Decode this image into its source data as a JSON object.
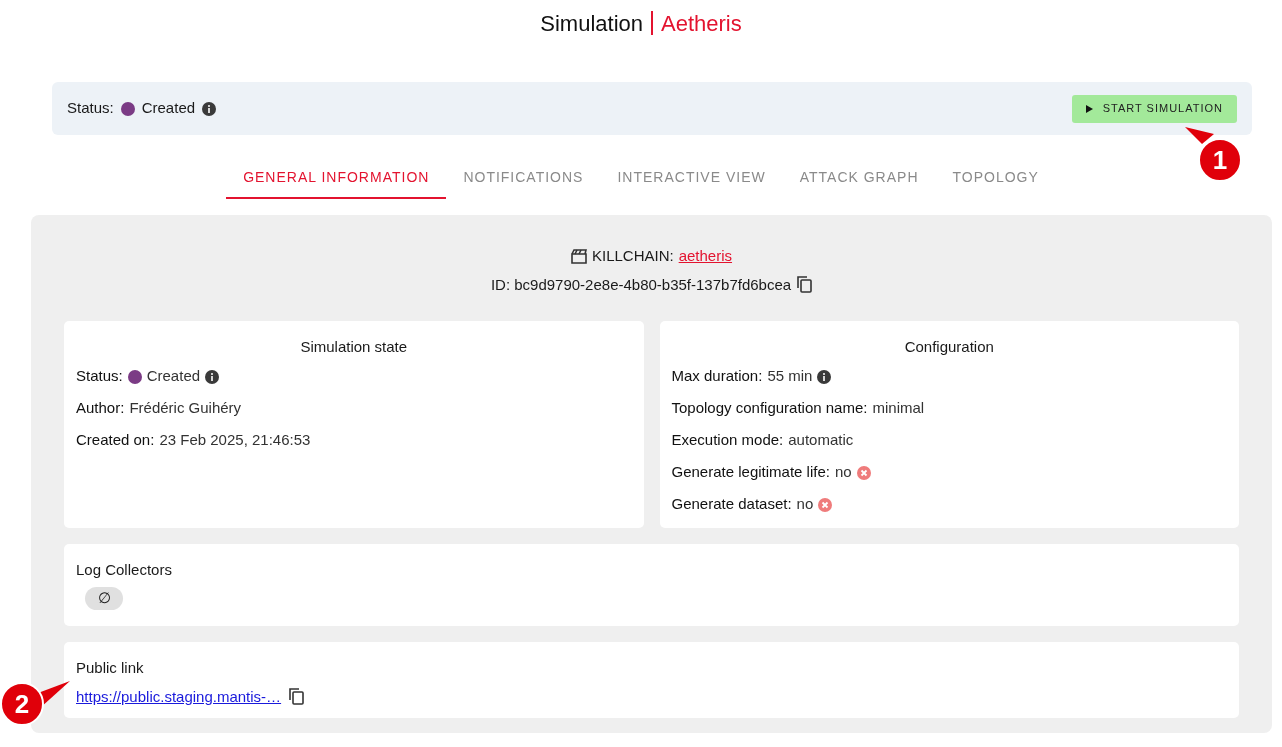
{
  "header": {
    "title": "Simulation",
    "subtitle": "Aetheris"
  },
  "status_bar": {
    "label": "Status:",
    "value": "Created",
    "color": "#7b3b85",
    "button": "START SIMULATION"
  },
  "tabs": [
    {
      "label": "GENERAL INFORMATION",
      "selected": true
    },
    {
      "label": "NOTIFICATIONS",
      "selected": false
    },
    {
      "label": "INTERACTIVE VIEW",
      "selected": false
    },
    {
      "label": "ATTACK GRAPH",
      "selected": false
    },
    {
      "label": "TOPOLOGY",
      "selected": false
    }
  ],
  "killchain": {
    "label": "KILLCHAIN:",
    "link": "aetheris",
    "id": "ID: bc9d9790-2e8e-4b80-b35f-137b7fd6bcea"
  },
  "simulation_state": {
    "title": "Simulation state",
    "fields": [
      {
        "kind": "status",
        "label": "Status:",
        "value": "Created",
        "color": "#7b3b85"
      },
      {
        "kind": "text",
        "label": "Author:",
        "value": "Frédéric Guihéry"
      },
      {
        "kind": "text",
        "label": "Created on:",
        "value": "23 Feb 2025, 21:46:53"
      }
    ]
  },
  "configuration": {
    "title": "Configuration",
    "fields": [
      {
        "kind": "info",
        "label": "Max duration:",
        "value": "55 min"
      },
      {
        "kind": "text",
        "label": "Topology configuration name:",
        "value": "minimal"
      },
      {
        "kind": "text",
        "label": "Execution mode:",
        "value": "automatic"
      },
      {
        "kind": "no",
        "label": "Generate legitimate life:",
        "value": "no"
      },
      {
        "kind": "no",
        "label": "Generate dataset:",
        "value": "no"
      }
    ]
  },
  "log_collectors": {
    "title": "Log Collectors",
    "chip": "∅"
  },
  "public_link": {
    "title": "Public link",
    "link": "https://public.staging.mantis-…"
  },
  "callouts": [
    {
      "number": "1",
      "kind": "up-left"
    },
    {
      "number": "2",
      "kind": "up-right"
    }
  ]
}
